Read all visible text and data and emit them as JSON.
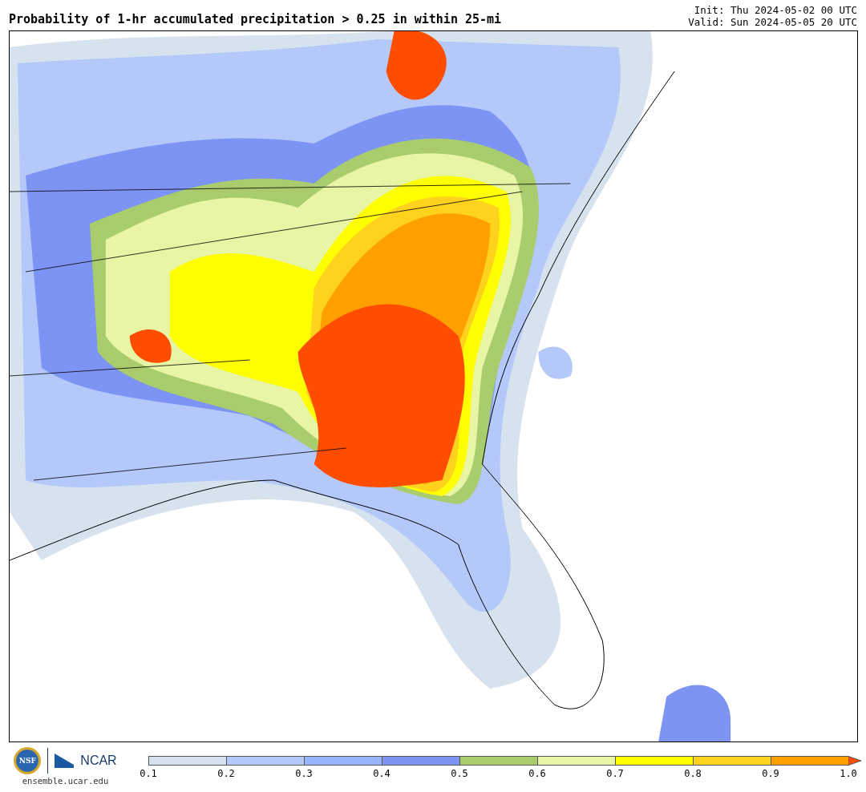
{
  "title": "Probability of 1-hr accumulated precipitation > 0.25 in within 25-mi",
  "init": "Init: Thu 2024-05-02 00 UTC",
  "valid": "Valid: Sun 2024-05-05 20 UTC",
  "logos": {
    "nsf": "NSF",
    "ncar": "NCAR",
    "url": "ensemble.ucar.edu"
  },
  "colorbar": {
    "bins": [
      {
        "color": "#d6e2ed"
      },
      {
        "color": "#b4c8fa"
      },
      {
        "color": "#96b4fa"
      },
      {
        "color": "#7d94f5"
      },
      {
        "color": "#a9cd6c"
      },
      {
        "color": "#e8f5a4"
      },
      {
        "color": "#ffff00"
      },
      {
        "color": "#ffd21e"
      },
      {
        "color": "#ff9f00"
      }
    ],
    "extend": {
      "color": "#ff4d00"
    },
    "ticks": [
      "0.1",
      "0.2",
      "0.3",
      "0.4",
      "0.5",
      "0.6",
      "0.7",
      "0.8",
      "0.9",
      "1.0"
    ]
  }
}
